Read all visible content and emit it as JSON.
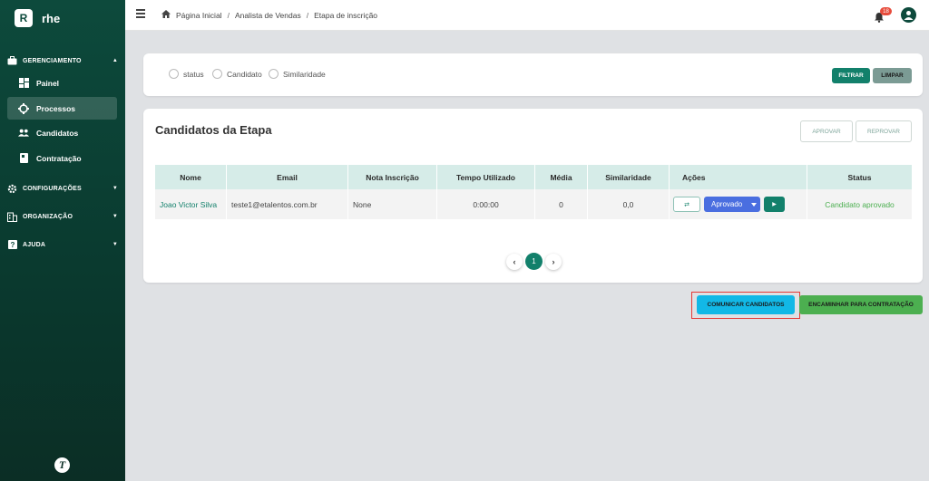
{
  "app": {
    "logo_letter": "R",
    "name": "rhe"
  },
  "sidebar": {
    "sections": [
      {
        "label": "GERENCIAMENTO",
        "icon": "briefcase-icon",
        "caret": "▲"
      },
      {
        "label": "CONFIGURAÇÕES",
        "icon": "gear-icon",
        "caret": "▼"
      },
      {
        "label": "ORGANIZAÇÃO",
        "icon": "building-icon",
        "caret": "▼"
      },
      {
        "label": "AJUDA",
        "icon": "help-icon",
        "caret": "▼"
      }
    ],
    "items": [
      {
        "label": "Painel",
        "icon": "dashboard-icon"
      },
      {
        "label": "Processos",
        "icon": "process-icon",
        "active": true
      },
      {
        "label": "Candidatos",
        "icon": "people-icon"
      },
      {
        "label": "Contratação",
        "icon": "contract-icon"
      }
    ],
    "footer_logo": "T"
  },
  "topbar": {
    "breadcrumb": [
      "Página Inicial",
      "Analista de Vendas",
      "Etapa de inscrição"
    ],
    "separator": "/",
    "notifications_count": "18"
  },
  "filters": {
    "options": [
      "status",
      "Candidato",
      "Similaridade"
    ],
    "filter_label": "FILTRAR",
    "clear_label": "LIMPAR"
  },
  "stage": {
    "title": "Candidatos da Etapa",
    "approve_label": "APROVAR",
    "reject_label": "REPROVAR"
  },
  "table": {
    "headers": [
      "Nome",
      "Email",
      "Nota Inscrição",
      "Tempo Utilizado",
      "Média",
      "Similaridade",
      "Ações",
      "Status"
    ],
    "rows": [
      {
        "nome": "Joao Victor Silva",
        "email": "teste1@etalentos.com.br",
        "nota": "None",
        "tempo": "0:00:00",
        "media": "0",
        "similaridade": "0,0",
        "acao_select": "Aprovado",
        "status": "Candidato aprovado"
      }
    ]
  },
  "pagination": {
    "current": "1",
    "prev": "‹",
    "next": "›"
  },
  "actions": {
    "communicate_label": "COMUNICAR CANDIDATOS",
    "forward_label": "ENCAMINHAR PARA CONTRATAÇÃO"
  }
}
